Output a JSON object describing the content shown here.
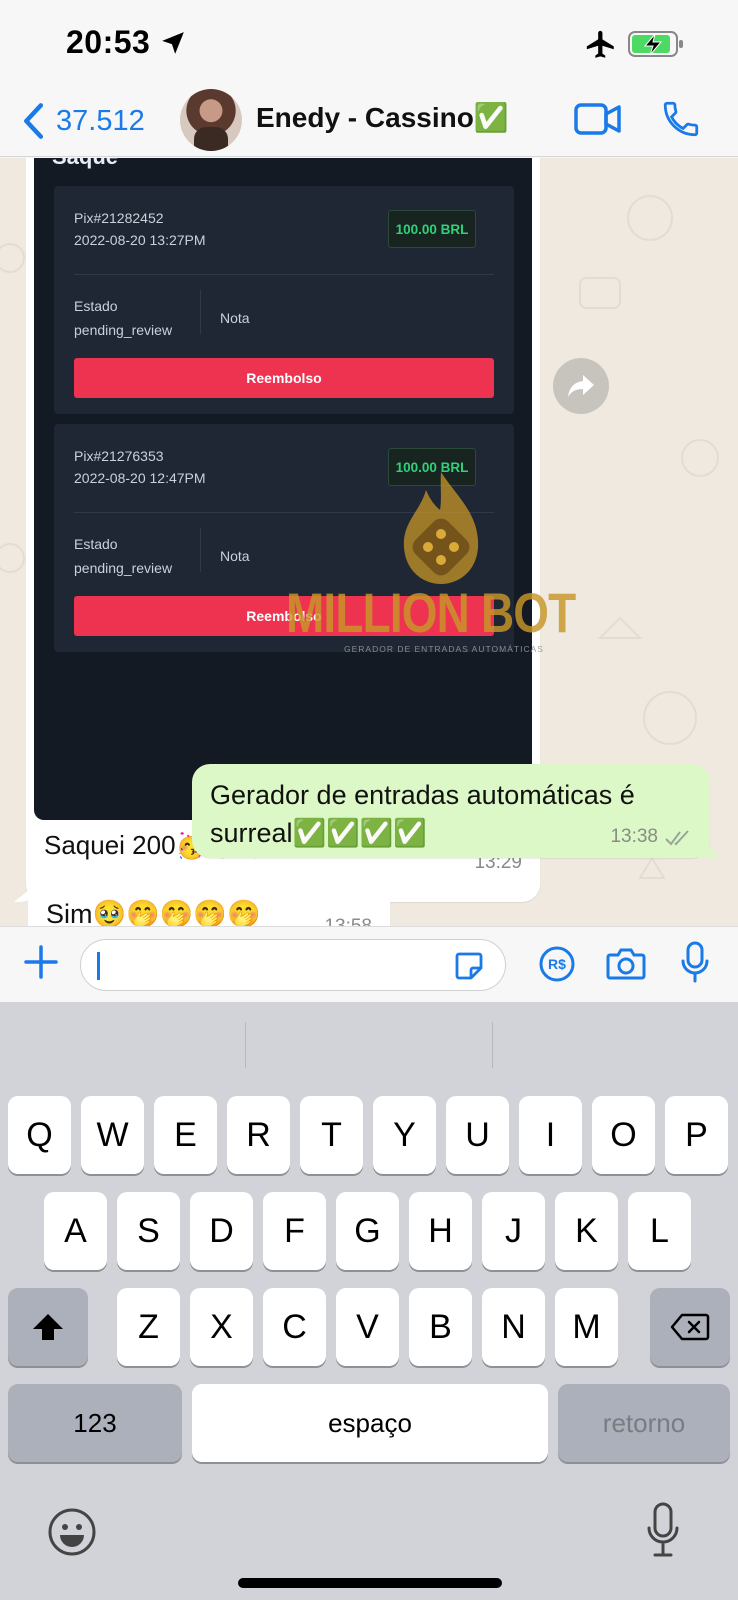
{
  "status_bar": {
    "time": "20:53"
  },
  "header": {
    "back_count": "37.512",
    "contact_name": "Enedy - Cassino✅"
  },
  "screenshot": {
    "title": "Saque",
    "withdrawals": [
      {
        "id": "Pix#21282452",
        "date": "2022-08-20 13:27PM",
        "amount": "100.00 BRL",
        "estado_label": "Estado",
        "estado_value": "pending_review",
        "nota_label": "Nota",
        "button": "Reembolso"
      },
      {
        "id": "Pix#21276353",
        "date": "2022-08-20 12:47PM",
        "amount": "100.00 BRL",
        "estado_label": "Estado",
        "estado_value": "pending_review",
        "nota_label": "Nota",
        "button": "Reembolso"
      }
    ],
    "watermark": {
      "brand": "MILLION BOT",
      "tagline": "GERADOR DE ENTRADAS AUTOMÁTICAS"
    }
  },
  "messages": [
    {
      "direction": "in",
      "text": "Saquei 200🥳🤭🥹",
      "time": "13:29"
    },
    {
      "direction": "out",
      "text": "Gerador de entradas automáticas é surreal✅✅✅✅",
      "time": "13:38"
    },
    {
      "direction": "in",
      "text": "Sim🥹🤭🤭🤭🤭",
      "time": "13:58"
    }
  ],
  "keyboard": {
    "row1": [
      "Q",
      "W",
      "E",
      "R",
      "T",
      "Y",
      "U",
      "I",
      "O",
      "P"
    ],
    "row2": [
      "A",
      "S",
      "D",
      "F",
      "G",
      "H",
      "J",
      "K",
      "L"
    ],
    "row3": [
      "Z",
      "X",
      "C",
      "V",
      "B",
      "N",
      "M"
    ],
    "numbers_key": "123",
    "space_key": "espaço",
    "return_key": "retorno"
  },
  "colors": {
    "accent": "#1a7ae8",
    "outgoing_bubble": "#dcf8c6",
    "chat_bg": "#efe9df",
    "refund_button": "#ee3350",
    "amount_green": "#2fd27a"
  }
}
